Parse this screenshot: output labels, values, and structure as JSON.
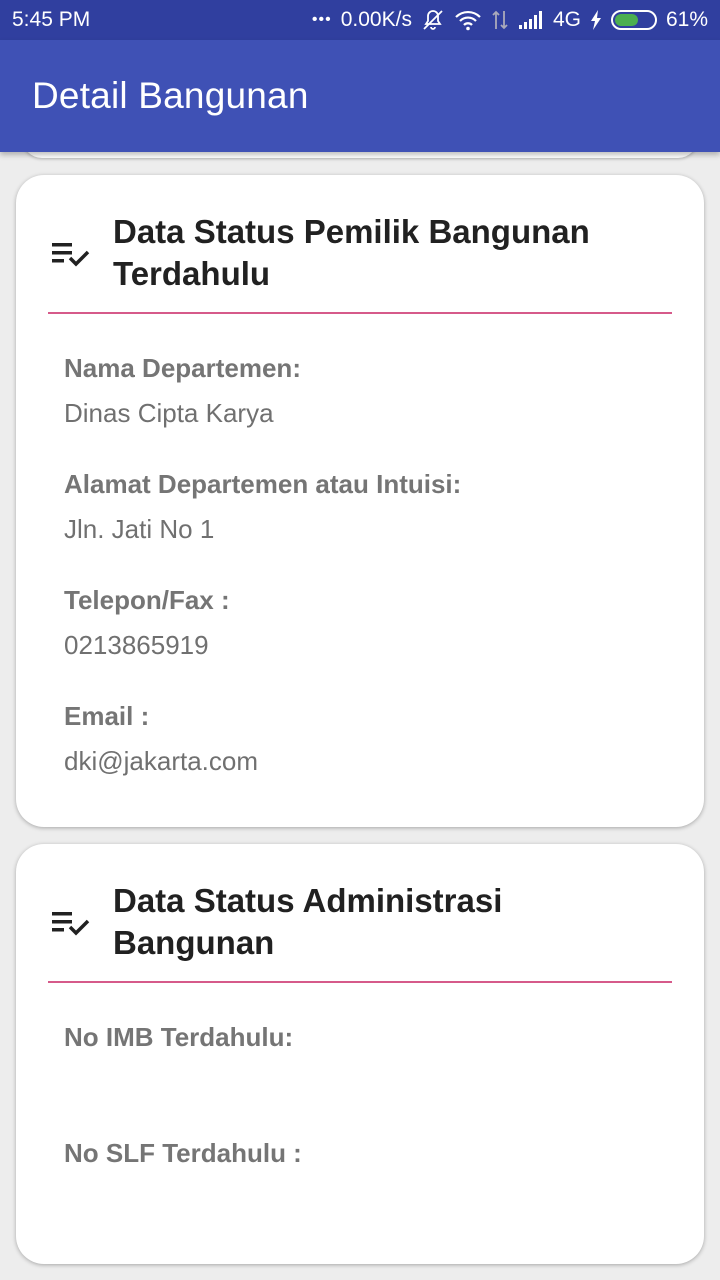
{
  "status_bar": {
    "time": "5:45 PM",
    "dots": "•••",
    "speed": "0.00K/s",
    "network": "4G",
    "battery_percent": "61%",
    "battery_level": 0.61
  },
  "app_bar": {
    "title": "Detail Bangunan"
  },
  "cards": [
    {
      "icon": "checklist-icon",
      "title": "Data Status Pemilik Bangunan Terdahulu",
      "fields": [
        {
          "label": "Nama Departemen:",
          "value": "Dinas Cipta Karya"
        },
        {
          "label": "Alamat Departemen atau Intuisi:",
          "value": "Jln. Jati No 1"
        },
        {
          "label": "Telepon/Fax :",
          "value": "0213865919"
        },
        {
          "label": "Email :",
          "value": "dki@jakarta.com"
        }
      ]
    },
    {
      "icon": "checklist-icon",
      "title": "Data Status Administrasi Bangunan",
      "fields": [
        {
          "label": "No IMB Terdahulu:",
          "value": ""
        },
        {
          "label": "No SLF Terdahulu :",
          "value": ""
        }
      ]
    }
  ],
  "colors": {
    "status_bar": "#303f9f",
    "app_bar": "#3f51b5",
    "divider": "#d65a8a",
    "background": "#ededed"
  }
}
